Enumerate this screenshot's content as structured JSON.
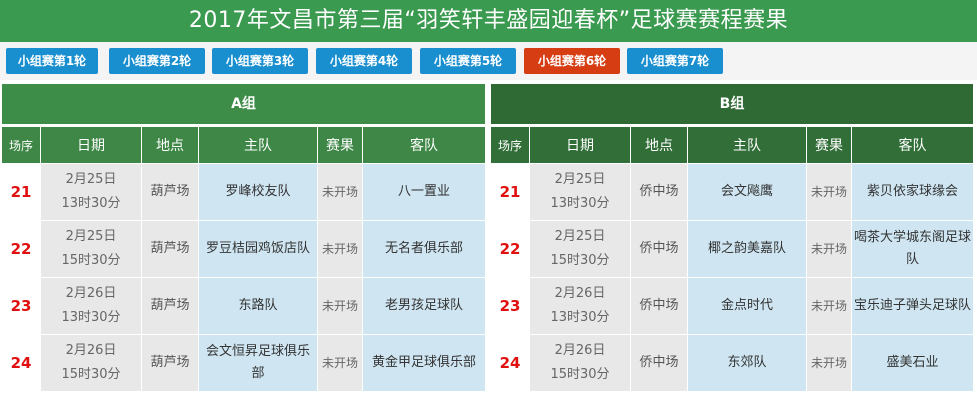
{
  "header": {
    "title": "2017年文昌市第三届“羽笑轩丰盛园迎春杯”足球赛赛程赛果"
  },
  "tabs": [
    {
      "label": "小组赛第1轮",
      "active": false
    },
    {
      "label": "小组赛第2轮",
      "active": false
    },
    {
      "label": "小组赛第3轮",
      "active": false
    },
    {
      "label": "小组赛第4轮",
      "active": false
    },
    {
      "label": "小组赛第5轮",
      "active": false
    },
    {
      "label": "小组赛第6轮",
      "active": true
    },
    {
      "label": "小组赛第7轮",
      "active": false
    }
  ],
  "columns": {
    "seq": "场序",
    "date": "日期",
    "venue": "地点",
    "home": "主队",
    "result": "赛果",
    "away": "客队"
  },
  "group_a": {
    "name": "A组",
    "rows": [
      {
        "seq": "21",
        "date": "2月25日",
        "time": "13时30分",
        "venue": "葫芦场",
        "home": "罗峰校友队",
        "result": "未开场",
        "away": "八一置业"
      },
      {
        "seq": "22",
        "date": "2月25日",
        "time": "15时30分",
        "venue": "葫芦场",
        "home": "罗豆桔园鸡饭店队",
        "result": "未开场",
        "away": "无名者俱乐部"
      },
      {
        "seq": "23",
        "date": "2月26日",
        "time": "13时30分",
        "venue": "葫芦场",
        "home": "东路队",
        "result": "未开场",
        "away": "老男孩足球队"
      },
      {
        "seq": "24",
        "date": "2月26日",
        "time": "15时30分",
        "venue": "葫芦场",
        "home": "会文恒昇足球俱乐部",
        "result": "未开场",
        "away": "黄金甲足球俱乐部"
      }
    ]
  },
  "group_b": {
    "name": "B组",
    "rows": [
      {
        "seq": "21",
        "date": "2月25日",
        "time": "13时30分",
        "venue": "侨中场",
        "home": "会文飚鹰",
        "result": "未开场",
        "away": "紫贝依家球缘会"
      },
      {
        "seq": "22",
        "date": "2月25日",
        "time": "15时30分",
        "venue": "侨中场",
        "home": "椰之韵美嘉队",
        "result": "未开场",
        "away": "喝茶大学城东阁足球队"
      },
      {
        "seq": "23",
        "date": "2月26日",
        "time": "13时30分",
        "venue": "侨中场",
        "home": "金点时代",
        "result": "未开场",
        "away": "宝乐迪子弹头足球队"
      },
      {
        "seq": "24",
        "date": "2月26日",
        "time": "15时30分",
        "venue": "侨中场",
        "home": "东郊队",
        "result": "未开场",
        "away": "盛美石业"
      }
    ]
  }
}
